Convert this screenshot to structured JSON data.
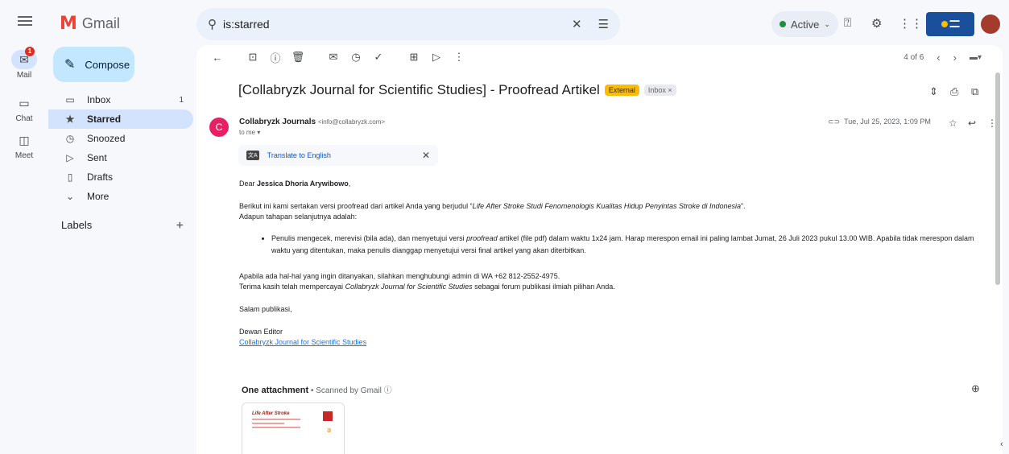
{
  "app": {
    "name": "Gmail"
  },
  "rail": [
    {
      "label": "Mail",
      "icon": "mail-icon",
      "badge": "1",
      "active": true
    },
    {
      "label": "Chat",
      "icon": "chat-icon"
    },
    {
      "label": "Meet",
      "icon": "meet-icon"
    }
  ],
  "search": {
    "value": "is:starred"
  },
  "status": {
    "label": "Active"
  },
  "compose": {
    "label": "Compose"
  },
  "nav": [
    {
      "label": "Inbox",
      "count": "1",
      "icon": "inbox-icon"
    },
    {
      "label": "Starred",
      "count": "",
      "icon": "star-icon",
      "selected": true
    },
    {
      "label": "Snoozed",
      "count": "",
      "icon": "clock-icon"
    },
    {
      "label": "Sent",
      "count": "",
      "icon": "send-icon"
    },
    {
      "label": "Drafts",
      "count": "",
      "icon": "draft-icon"
    },
    {
      "label": "More",
      "count": "",
      "icon": "chevron-down-icon"
    }
  ],
  "labels": {
    "title": "Labels"
  },
  "pager": {
    "text": "4 of 6"
  },
  "email": {
    "subject": "[Collabryzk Journal for Scientific Studies] - Proofread Artikel",
    "tag_external": "External",
    "tag_inbox": "Inbox ×",
    "sender_initial": "C",
    "sender_name": "Collabryzk Journals",
    "sender_email": "<info@collabryzk.com>",
    "to": "to me ▾",
    "date": "Tue, Jul 25, 2023, 1:09 PM",
    "translate": "Translate to English",
    "greeting_prefix": "Dear ",
    "greeting_name": "Jessica Dhoria Arywibowo",
    "greeting_suffix": ",",
    "p1_a": "Berikut ini kami sertakan versi proofread dari artikel Anda yang berjudul “",
    "p1_title": "Life After Stroke Studi Fenomenologis Kualitas Hidup Penyintas Stroke di Indonesia",
    "p1_b": "”.",
    "p1_c": "Adapun tahapan selanjutnya adalah:",
    "bullet_a": "Penulis mengecek, merevisi (bila ada), dan menyetujui versi ",
    "bullet_em": "proofread",
    "bullet_b": " artikel (file pdf) dalam waktu 1x24 jam. Harap merespon email ini paling lambat Jumat, 26 Juli 2023 pukul 13.00 WIB. Apabila tidak merespon dalam waktu yang ditentukan, maka penulis dianggap menyetujui versi final artikel yang akan diterbitkan.",
    "p2_a": "Apabila ada hal-hal yang ingin ditanyakan, silahkan menghubungi admin di WA +62 812-2552-4975.",
    "p2_b": "Terima kasih telah mempercayai ",
    "p2_em": "Collabryzk Journal for Scientific Studies",
    "p2_c": " sebagai forum publikasi ilmiah pilihan Anda.",
    "closing": "Salam publikasi,",
    "sig_1": "Dewan Editor",
    "sig_link": "Collabryzk Journal for Scientific Studies",
    "attach_title": "One attachment",
    "attach_scan": " • Scanned by Gmail ⓘ",
    "thumb_title": "Life After Stroke"
  }
}
